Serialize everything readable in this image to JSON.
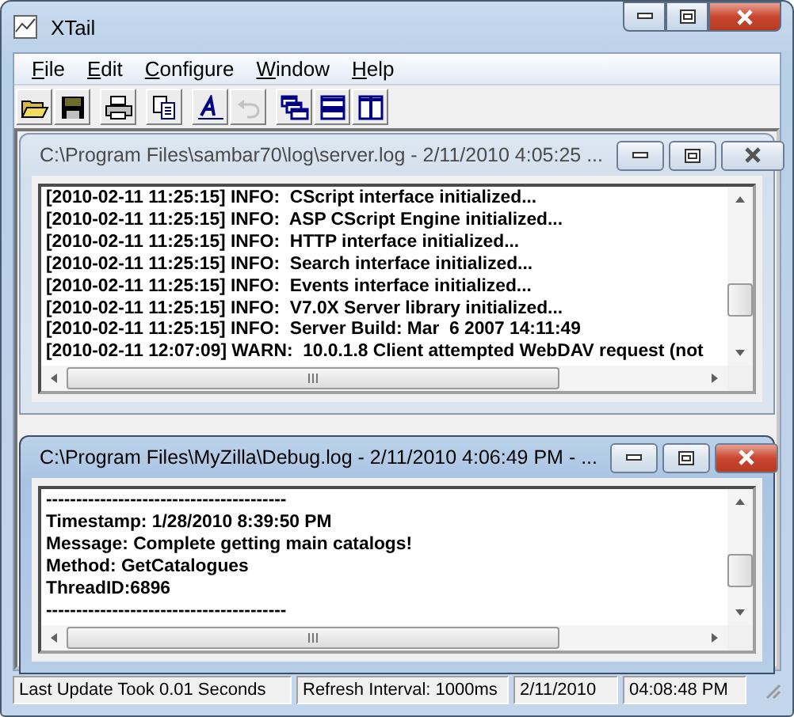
{
  "window": {
    "title": "XTail"
  },
  "menu": [
    {
      "label": "File"
    },
    {
      "label": "Edit"
    },
    {
      "label": "Configure"
    },
    {
      "label": "Window"
    },
    {
      "label": "Help"
    }
  ],
  "toolbar": [
    [
      {
        "kind": "open",
        "disabled": false
      },
      {
        "kind": "save",
        "disabled": false
      }
    ],
    [
      {
        "kind": "print",
        "disabled": false
      }
    ],
    [
      {
        "kind": "copy",
        "disabled": false
      }
    ],
    [
      {
        "kind": "font",
        "disabled": false
      },
      {
        "kind": "undo",
        "disabled": true
      }
    ],
    [
      {
        "kind": "cascade",
        "disabled": false
      },
      {
        "kind": "tile_horizontal",
        "disabled": false
      },
      {
        "kind": "tile_vertical",
        "disabled": false
      }
    ]
  ],
  "documents": [
    {
      "title": "C:\\Program Files\\sambar70\\log\\server.log - 2/11/2010 4:05:25 ...",
      "active": false,
      "lines": [
        "[2010-02-11 11:25:15] INFO:  CScript interface initialized...",
        "[2010-02-11 11:25:15] INFO:  ASP CScript Engine initialized...",
        "[2010-02-11 11:25:15] INFO:  HTTP interface initialized...",
        "[2010-02-11 11:25:15] INFO:  Search interface initialized...",
        "[2010-02-11 11:25:15] INFO:  Events interface initialized...",
        "[2010-02-11 11:25:15] INFO:  V7.0X Server library initialized...",
        "[2010-02-11 11:25:15] INFO:  Server Build: Mar  6 2007 14:11:49",
        "[2010-02-11 12:07:09] WARN:  10.0.1.8 Client attempted WebDAV request (not"
      ]
    },
    {
      "title": "C:\\Program Files\\MyZilla\\Debug.log - 2/11/2010 4:06:49 PM - ...",
      "active": true,
      "lines": [
        "----------------------------------------",
        "Timestamp: 1/28/2010 8:39:50 PM",
        "Message: Complete getting main catalogs!",
        "Method: GetCatalogues",
        "ThreadID:6896",
        "----------------------------------------"
      ]
    }
  ],
  "status_bar": [
    "Last Update Took 0.01 Seconds",
    "Refresh Interval: 1000ms",
    "2/11/2010",
    "04:08:48 PM"
  ]
}
